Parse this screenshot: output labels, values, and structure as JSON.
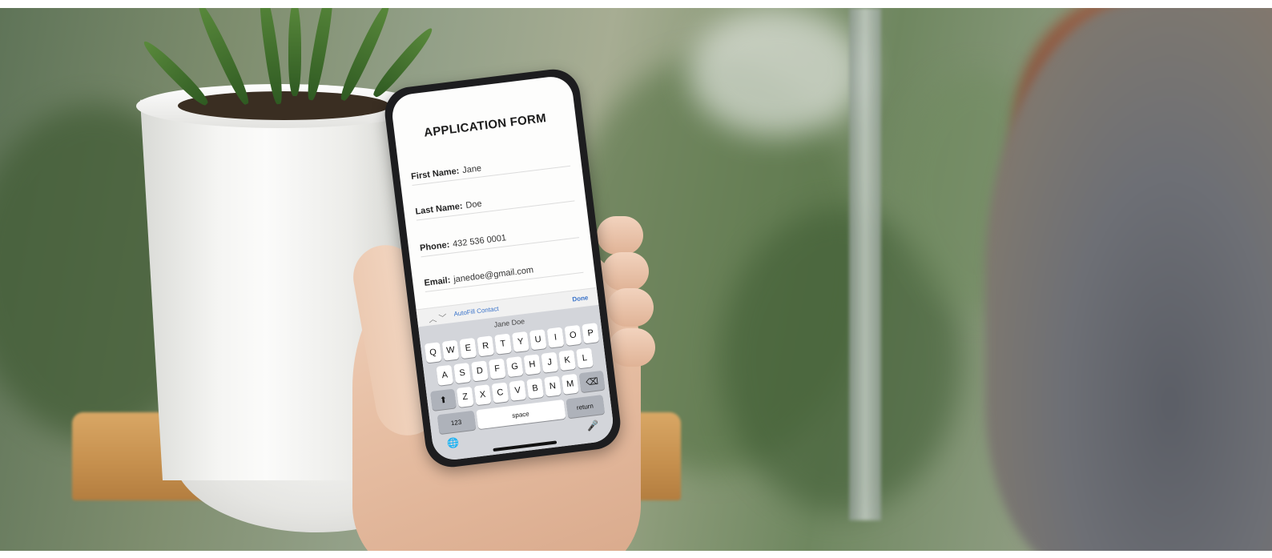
{
  "form": {
    "title": "APPLICATION FORM",
    "fields": [
      {
        "label": "First Name:",
        "value": "Jane"
      },
      {
        "label": "Last Name:",
        "value": "Doe"
      },
      {
        "label": "Phone:",
        "value": "432 536 0001"
      },
      {
        "label": "Email:",
        "value": "janedoe@gmail.com"
      }
    ]
  },
  "keyboard": {
    "autofill_label": "AutoFill Contact",
    "done_label": "Done",
    "suggestion": "Jane Doe",
    "row1": [
      "Q",
      "W",
      "E",
      "R",
      "T",
      "Y",
      "U",
      "I",
      "O",
      "P"
    ],
    "row2": [
      "A",
      "S",
      "D",
      "F",
      "G",
      "H",
      "J",
      "K",
      "L"
    ],
    "row3": [
      "Z",
      "X",
      "C",
      "V",
      "B",
      "N",
      "M"
    ],
    "shift_icon": "⬆",
    "delete_icon": "⌫",
    "numbers_label": "123",
    "space_label": "space",
    "return_label": "return",
    "globe_icon": "🌐",
    "mic_icon": "🎤"
  }
}
